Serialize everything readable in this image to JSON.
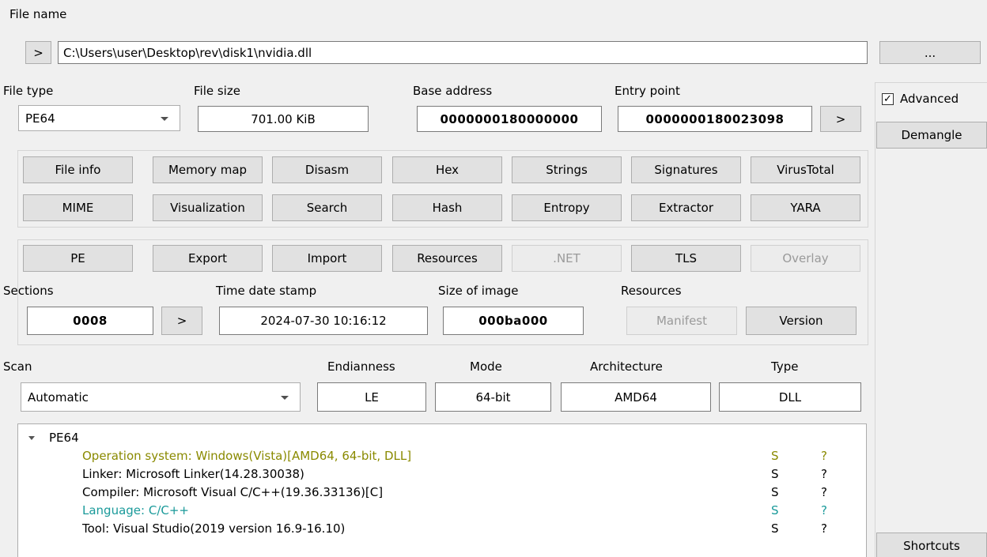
{
  "file_name": {
    "label": "File name",
    "go_label": ">",
    "path": "C:\\Users\\user\\Desktop\\rev\\disk1\\nvidia.dll",
    "browse_label": "..."
  },
  "file_type": {
    "label": "File type",
    "value": "PE64"
  },
  "file_size": {
    "label": "File size",
    "value": "701.00 KiB"
  },
  "base_address": {
    "label": "Base address",
    "value": "0000000180000000"
  },
  "entry_point": {
    "label": "Entry point",
    "value": "0000000180023098",
    "go_label": ">"
  },
  "side": {
    "advanced_label": "Advanced",
    "advanced_checked": true,
    "demangle_label": "Demangle",
    "shortcuts_label": "Shortcuts"
  },
  "tools_row1": [
    "File info",
    "Memory map",
    "Disasm",
    "Hex",
    "Strings",
    "Signatures",
    "VirusTotal"
  ],
  "tools_row2": [
    "MIME",
    "Visualization",
    "Search",
    "Hash",
    "Entropy",
    "Extractor",
    "YARA"
  ],
  "pe_row": [
    {
      "label": "PE",
      "enabled": true
    },
    {
      "label": "Export",
      "enabled": true
    },
    {
      "label": "Import",
      "enabled": true
    },
    {
      "label": "Resources",
      "enabled": true
    },
    {
      "label": ".NET",
      "enabled": false
    },
    {
      "label": "TLS",
      "enabled": true
    },
    {
      "label": "Overlay",
      "enabled": false
    }
  ],
  "sections": {
    "label": "Sections",
    "value": "0008",
    "go_label": ">"
  },
  "time_date_stamp": {
    "label": "Time date stamp",
    "value": "2024-07-30 10:16:12"
  },
  "size_of_image": {
    "label": "Size of image",
    "value": "000ba000"
  },
  "resources": {
    "label": "Resources",
    "manifest_label": "Manifest",
    "version_label": "Version"
  },
  "scan": {
    "label": "Scan",
    "value": "Automatic"
  },
  "endianness": {
    "label": "Endianness",
    "value": "LE"
  },
  "mode": {
    "label": "Mode",
    "value": "64-bit"
  },
  "architecture": {
    "label": "Architecture",
    "value": "AMD64"
  },
  "type": {
    "label": "Type",
    "value": "DLL"
  },
  "results": {
    "root": "PE64",
    "items": [
      {
        "text": "Operation system: Windows(Vista)[AMD64, 64-bit, DLL]",
        "s": "S",
        "q": "?",
        "color": "#8a8a00"
      },
      {
        "text": "Linker: Microsoft Linker(14.28.30038)",
        "s": "S",
        "q": "?",
        "color": "#000000"
      },
      {
        "text": "Compiler: Microsoft Visual C/C++(19.36.33136)[C]",
        "s": "S",
        "q": "?",
        "color": "#000000"
      },
      {
        "text": "Language: C/C++",
        "s": "S",
        "q": "?",
        "color": "#1a9a9a"
      },
      {
        "text": "Tool: Visual Studio(2019 version 16.9-16.10)",
        "s": "S",
        "q": "?",
        "color": "#000000"
      }
    ]
  }
}
